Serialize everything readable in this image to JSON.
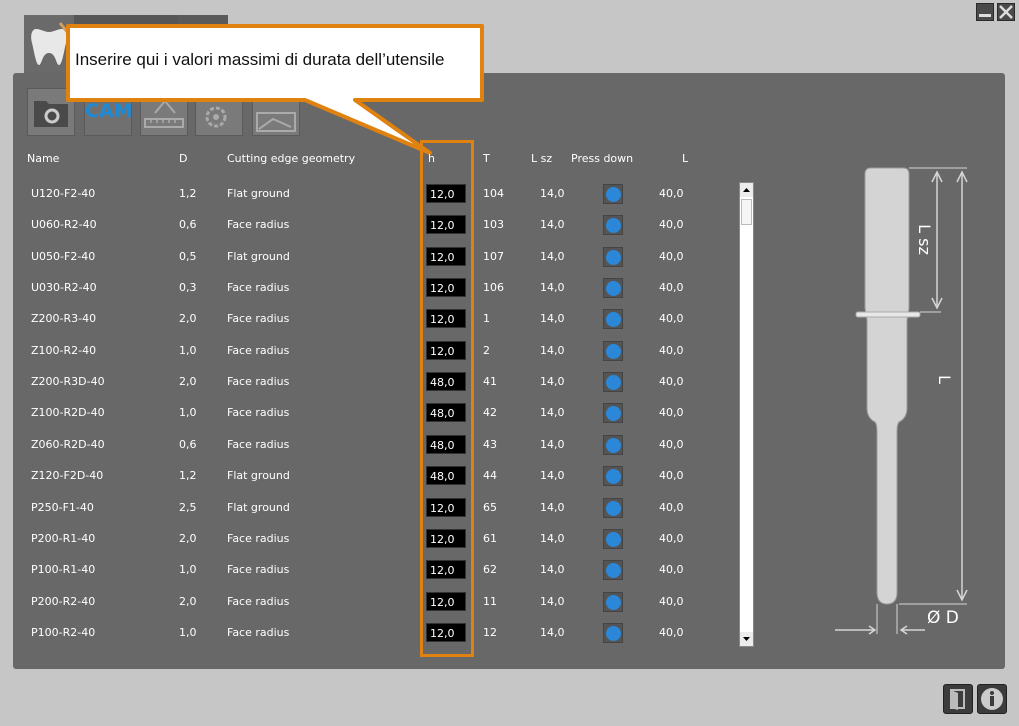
{
  "callout": {
    "text": "Inserire qui i valori massimi di durata dell’utensile"
  },
  "sub_tabs": {
    "cam_label": "CAM"
  },
  "headers": {
    "name": "Name",
    "d": "D",
    "geometry": "Cutting edge geometry",
    "h": "h",
    "t": "T",
    "lsz": "L sz",
    "press_down": "Press down",
    "l": "L"
  },
  "rows": [
    {
      "name": "U120-F2-40",
      "d": "1,2",
      "geometry": "Flat ground",
      "h": "12,0",
      "t": "104",
      "lsz": "14,0",
      "l": "40,0"
    },
    {
      "name": "U060-R2-40",
      "d": "0,6",
      "geometry": "Face radius",
      "h": "12,0",
      "t": "103",
      "lsz": "14,0",
      "l": "40,0"
    },
    {
      "name": "U050-F2-40",
      "d": "0,5",
      "geometry": "Flat ground",
      "h": "12,0",
      "t": "107",
      "lsz": "14,0",
      "l": "40,0"
    },
    {
      "name": "U030-R2-40",
      "d": "0,3",
      "geometry": "Face radius",
      "h": "12,0",
      "t": "106",
      "lsz": "14,0",
      "l": "40,0"
    },
    {
      "name": "Z200-R3-40",
      "d": "2,0",
      "geometry": "Face radius",
      "h": "12,0",
      "t": "1",
      "lsz": "14,0",
      "l": "40,0"
    },
    {
      "name": "Z100-R2-40",
      "d": "1,0",
      "geometry": "Face radius",
      "h": "12,0",
      "t": "2",
      "lsz": "14,0",
      "l": "40,0"
    },
    {
      "name": "Z200-R3D-40",
      "d": "2,0",
      "geometry": "Face radius",
      "h": "48,0",
      "t": "41",
      "lsz": "14,0",
      "l": "40,0"
    },
    {
      "name": "Z100-R2D-40",
      "d": "1,0",
      "geometry": "Face radius",
      "h": "48,0",
      "t": "42",
      "lsz": "14,0",
      "l": "40,0"
    },
    {
      "name": "Z060-R2D-40",
      "d": "0,6",
      "geometry": "Face radius",
      "h": "48,0",
      "t": "43",
      "lsz": "14,0",
      "l": "40,0"
    },
    {
      "name": "Z120-F2D-40",
      "d": "1,2",
      "geometry": "Flat ground",
      "h": "48,0",
      "t": "44",
      "lsz": "14,0",
      "l": "40,0"
    },
    {
      "name": "P250-F1-40",
      "d": "2,5",
      "geometry": "Flat ground",
      "h": "12,0",
      "t": "65",
      "lsz": "14,0",
      "l": "40,0"
    },
    {
      "name": "P200-R1-40",
      "d": "2,0",
      "geometry": "Face radius",
      "h": "12,0",
      "t": "61",
      "lsz": "14,0",
      "l": "40,0"
    },
    {
      "name": "P100-R1-40",
      "d": "1,0",
      "geometry": "Face radius",
      "h": "12,0",
      "t": "62",
      "lsz": "14,0",
      "l": "40,0"
    },
    {
      "name": "P200-R2-40",
      "d": "2,0",
      "geometry": "Face radius",
      "h": "12,0",
      "t": "11",
      "lsz": "14,0",
      "l": "40,0"
    },
    {
      "name": "P100-R2-40",
      "d": "1,0",
      "geometry": "Face radius",
      "h": "12,0",
      "t": "12",
      "lsz": "14,0",
      "l": "40,0"
    }
  ],
  "tool_diagram": {
    "lsz_label": "L sz",
    "l_label": "L",
    "d_label": "Ø D"
  },
  "colors": {
    "accent_orange": "#e0820f",
    "press_blue": "#2b88d8",
    "cam_blue": "#1e8ad6"
  }
}
